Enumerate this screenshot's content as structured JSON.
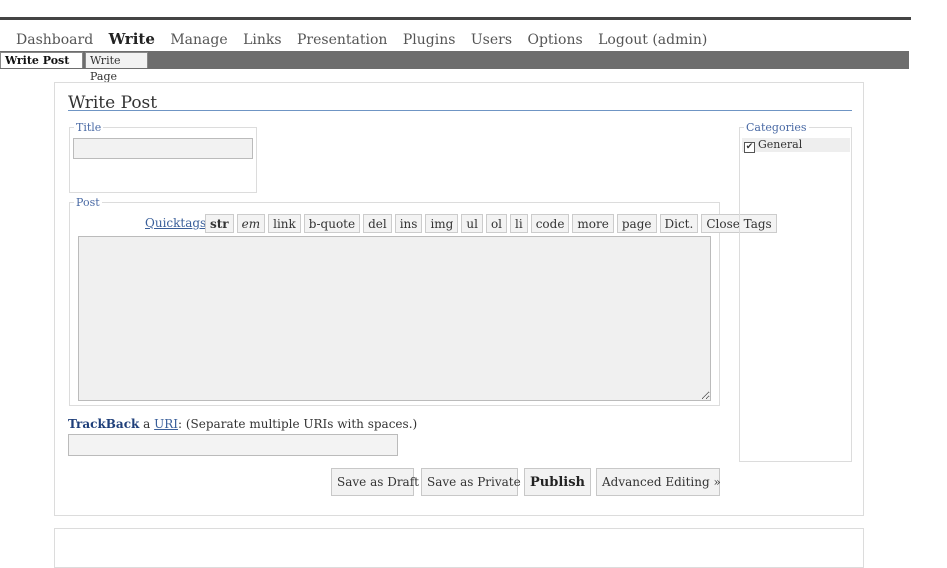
{
  "main_nav": [
    {
      "label": "Dashboard",
      "active": false
    },
    {
      "label": "Write",
      "active": true
    },
    {
      "label": "Manage",
      "active": false
    },
    {
      "label": "Links",
      "active": false
    },
    {
      "label": "Presentation",
      "active": false
    },
    {
      "label": "Plugins",
      "active": false
    },
    {
      "label": "Users",
      "active": false
    },
    {
      "label": "Options",
      "active": false
    },
    {
      "label": "Logout (admin)",
      "active": false
    }
  ],
  "sub_tabs": [
    {
      "label": "Write Post",
      "active": true
    },
    {
      "label": "Write Page",
      "active": false
    }
  ],
  "page_title": "Write Post",
  "title_field": {
    "legend": "Title",
    "value": ""
  },
  "post_field": {
    "legend": "Post",
    "quicktags_label": "Quicktags",
    "quicktags_colon": ":",
    "quicktags": [
      {
        "label": "str",
        "style": "bold"
      },
      {
        "label": "em",
        "style": "italic"
      },
      {
        "label": "link",
        "style": "normal"
      },
      {
        "label": "b-quote",
        "style": "normal"
      },
      {
        "label": "del",
        "style": "normal"
      },
      {
        "label": "ins",
        "style": "normal"
      },
      {
        "label": "img",
        "style": "normal"
      },
      {
        "label": "ul",
        "style": "normal"
      },
      {
        "label": "ol",
        "style": "normal"
      },
      {
        "label": "li",
        "style": "normal"
      },
      {
        "label": "code",
        "style": "normal"
      },
      {
        "label": "more",
        "style": "normal"
      },
      {
        "label": "page",
        "style": "normal"
      },
      {
        "label": "Dict.",
        "style": "normal"
      },
      {
        "label": "Close Tags",
        "style": "normal"
      }
    ],
    "content": ""
  },
  "categories": {
    "legend": "Categories",
    "items": [
      {
        "label": "General",
        "checked": true,
        "check_glyph": "✔"
      }
    ]
  },
  "trackback": {
    "link_label": "TrackBack",
    "a_text": " a ",
    "uri_label": "URI",
    "hint": ": (Separate multiple URIs with spaces.)",
    "value": ""
  },
  "actions": [
    {
      "label": "Save as Draft",
      "bold": false
    },
    {
      "label": "Save as Private",
      "bold": false
    },
    {
      "label": "Publish",
      "bold": true
    },
    {
      "label": "Advanced Editing »",
      "bold": false
    }
  ],
  "colors": {
    "subbar": "#6d6d6d",
    "link": "#3a5f9a",
    "title_rule": "#6f95c4"
  }
}
